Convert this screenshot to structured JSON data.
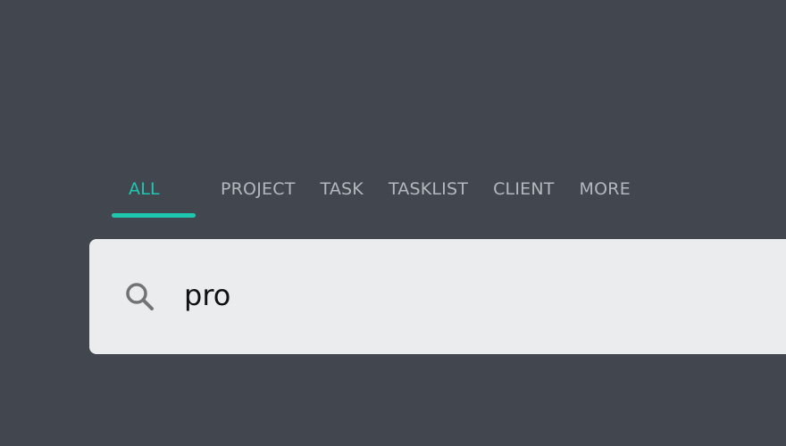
{
  "tabs": [
    {
      "label": "ALL",
      "active": true
    },
    {
      "label": "PROJECT",
      "active": false
    },
    {
      "label": "TASK",
      "active": false
    },
    {
      "label": "TASKLIST",
      "active": false
    },
    {
      "label": "CLIENT",
      "active": false
    },
    {
      "label": "MORE",
      "active": false
    }
  ],
  "search": {
    "icon": "search-icon",
    "value": "pro",
    "placeholder": ""
  },
  "colors": {
    "background": "#42474f",
    "accent": "#1ec8b0",
    "tab_inactive": "#b3b8bf",
    "search_bg": "#eaecee"
  }
}
